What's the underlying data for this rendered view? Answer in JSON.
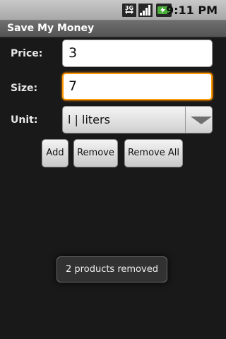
{
  "status_bar": {
    "time": "9:11 PM",
    "icons": [
      "3g-data-icon",
      "signal-strength-icon",
      "battery-charging-icon"
    ]
  },
  "app": {
    "title": "Save My Money"
  },
  "form": {
    "price_label": "Price:",
    "price_value": "3",
    "size_label": "Size:",
    "size_value": "7",
    "unit_label": "Unit:",
    "unit_value": "l | liters"
  },
  "buttons": {
    "add": "Add",
    "remove": "Remove",
    "remove_all": "Remove All"
  },
  "toast": {
    "message": "2 products removed"
  },
  "colors": {
    "focus_accent": "#ff9800",
    "background": "#191919",
    "title_bar": "#5f5f5f"
  }
}
